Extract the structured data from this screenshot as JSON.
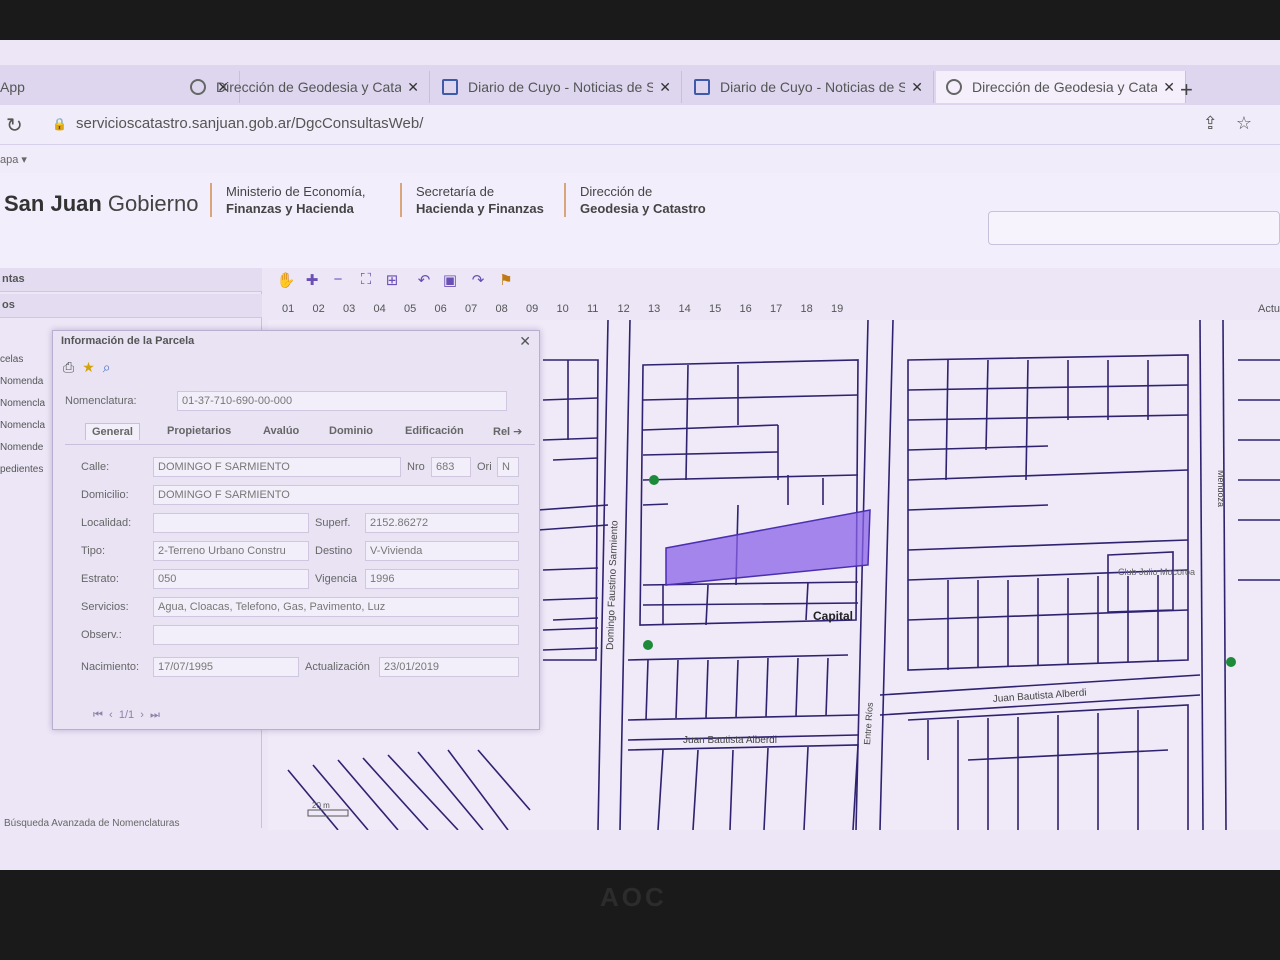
{
  "tabs": [
    {
      "label": "App",
      "icon": "apps-icon"
    },
    {
      "label": "Dirección de Geodesia y Catas",
      "icon": "globe-icon"
    },
    {
      "label": "Diario de Cuyo - Noticias de S",
      "icon": "news-icon"
    },
    {
      "label": "Diario de Cuyo - Noticias de S",
      "icon": "news-icon"
    },
    {
      "label": "Dirección de Geodesia y Catas",
      "icon": "globe-icon"
    }
  ],
  "address": {
    "url": "servicioscatastro.sanjuan.gob.ar/DgcConsultasWeb/"
  },
  "bookmarks": {
    "label": "apa ▾"
  },
  "header": {
    "brand_bold": "San Juan",
    "brand_rest": " Gobierno",
    "ministerio_1": "Ministerio de Economía,",
    "ministerio_2": "Finanzas y Hacienda",
    "secretaria_1": "Secretaría de",
    "secretaria_2": "Hacienda y Finanzas",
    "direccion_1": "Dirección de",
    "direccion_2": "Geodesia y Catastro"
  },
  "left_panel": {
    "head1": "ntas",
    "head2": "os",
    "items": [
      "celas",
      "Nomenda",
      "Nomencla",
      "Nomencla",
      "Nomende",
      "pedientes"
    ],
    "footer": "Búsqueda Avanzada de Nomenclaturas"
  },
  "ruler": [
    "01",
    "02",
    "03",
    "04",
    "05",
    "06",
    "07",
    "08",
    "09",
    "10",
    "11",
    "12",
    "13",
    "14",
    "15",
    "16",
    "17",
    "18",
    "19"
  ],
  "ruler_right": "Actu",
  "dialog": {
    "title": "Información de la Parcela",
    "nomenclatura_label": "Nomenclatura:",
    "nomenclatura_value": "01-37-710-690-00-000",
    "tabs": [
      "General",
      "Propietarios",
      "Avalúo",
      "Dominio",
      "Edificación",
      "Rel"
    ],
    "fields": {
      "calle_label": "Calle:",
      "calle_value": "DOMINGO F SARMIENTO",
      "nro_label": "Nro",
      "nro_value": "683",
      "ori_label": "Ori",
      "ori_value": "N",
      "domicilio_label": "Domicilio:",
      "domicilio_value": "DOMINGO F SARMIENTO",
      "localidad_label": "Localidad:",
      "localidad_value": "",
      "superf_label": "Superf.",
      "superf_value": "2152.86272",
      "tipo_label": "Tipo:",
      "tipo_value": "2-Terreno Urbano Constru",
      "destino_label": "Destino",
      "destino_value": "V-Vivienda",
      "estrato_label": "Estrato:",
      "estrato_value": "050",
      "vigencia_label": "Vigencia",
      "vigencia_value": "1996",
      "servicios_label": "Servicios:",
      "servicios_value": "Agua, Cloacas, Telefono, Gas, Pavimento, Luz",
      "observ_label": "Observ.:",
      "observ_value": "",
      "nacimiento_label": "Nacimiento:",
      "nacimiento_value": "17/07/1995",
      "actualizacion_label": "Actualización",
      "actualizacion_value": "23/01/2019"
    },
    "pager": "1/1"
  },
  "map_labels": {
    "street_sarmiento": "Domingo Faustino Sarmiento",
    "street_alberdi_1": "Juan Bautista Alberdi",
    "street_alberdi_2": "Juan Bautista Alberdi",
    "street_entre_rios": "Entre Ríos",
    "street_mendoza": "Mendoza",
    "poi_capital": "Capital",
    "poi_club": "Club Julio Mocoroa",
    "scale": "20 m"
  },
  "colors": {
    "accent": "#6a4fb5",
    "parcel_highlight": "#8a63e8",
    "lines": "#2f2270",
    "poi_dot": "#1d8a3a"
  },
  "taskbar_apps": [
    "start-icon",
    "folder-icon",
    "excel-icon",
    "chrome-icon",
    "chart-app-icon",
    "editor-icon",
    "word-icon",
    "pdf-icon"
  ]
}
